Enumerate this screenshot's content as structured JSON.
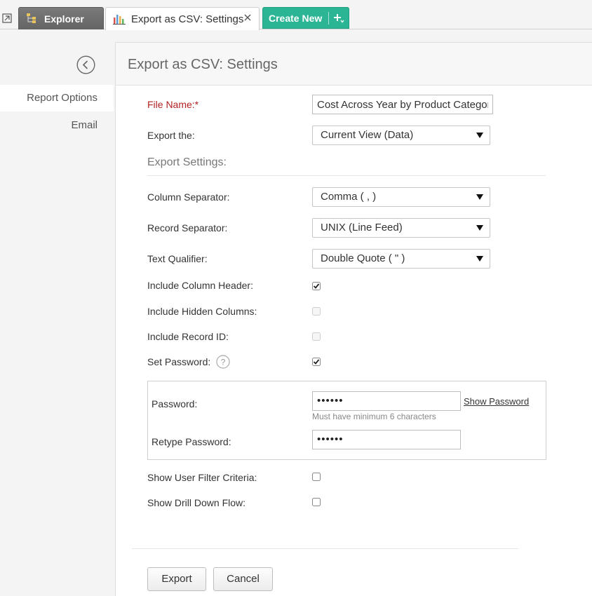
{
  "tabs": {
    "explorer_label": "Explorer",
    "active_label": "Export as CSV: Settings",
    "create_new_label": "Create New"
  },
  "sidebar": {
    "items": [
      {
        "label": "Report Options",
        "active": true
      },
      {
        "label": "Email",
        "active": false
      }
    ]
  },
  "panel": {
    "title": "Export as CSV: Settings"
  },
  "form": {
    "file_name_label": "File Name:*",
    "file_name_value": "Cost Across Year by Product Category",
    "export_the_label": "Export the:",
    "export_the_value": "Current View (Data)",
    "export_settings_heading": "Export Settings:",
    "column_separator_label": "Column Separator:",
    "column_separator_value": "Comma ( , )",
    "record_separator_label": "Record Separator:",
    "record_separator_value": "UNIX (Line Feed)",
    "text_qualifier_label": "Text Qualifier:",
    "text_qualifier_value": "Double Quote ( \" )",
    "include_column_header_label": "Include Column Header:",
    "include_column_header_checked": true,
    "include_hidden_columns_label": "Include Hidden Columns:",
    "include_hidden_columns_checked": false,
    "include_record_id_label": "Include Record ID:",
    "include_record_id_checked": false,
    "set_password_label": "Set Password:",
    "set_password_checked": true,
    "password_label": "Password:",
    "password_value": "••••••",
    "show_password_label": "Show Password",
    "password_hint": "Must have minimum 6 characters",
    "retype_password_label": "Retype Password:",
    "retype_password_value": "••••••",
    "show_user_filter_label": "Show User Filter Criteria:",
    "show_user_filter_checked": false,
    "show_drill_down_label": "Show Drill Down Flow:",
    "show_drill_down_checked": false
  },
  "buttons": {
    "export_label": "Export",
    "cancel_label": "Cancel"
  },
  "colors": {
    "accent_green": "#2bb594",
    "required_red": "#b22222"
  },
  "icons": [
    "restore-icon",
    "explorer-icon",
    "report-chart-icon",
    "close-icon",
    "add-icon",
    "back-icon",
    "chevron-down-icon",
    "help-icon",
    "checkbox-icon"
  ]
}
